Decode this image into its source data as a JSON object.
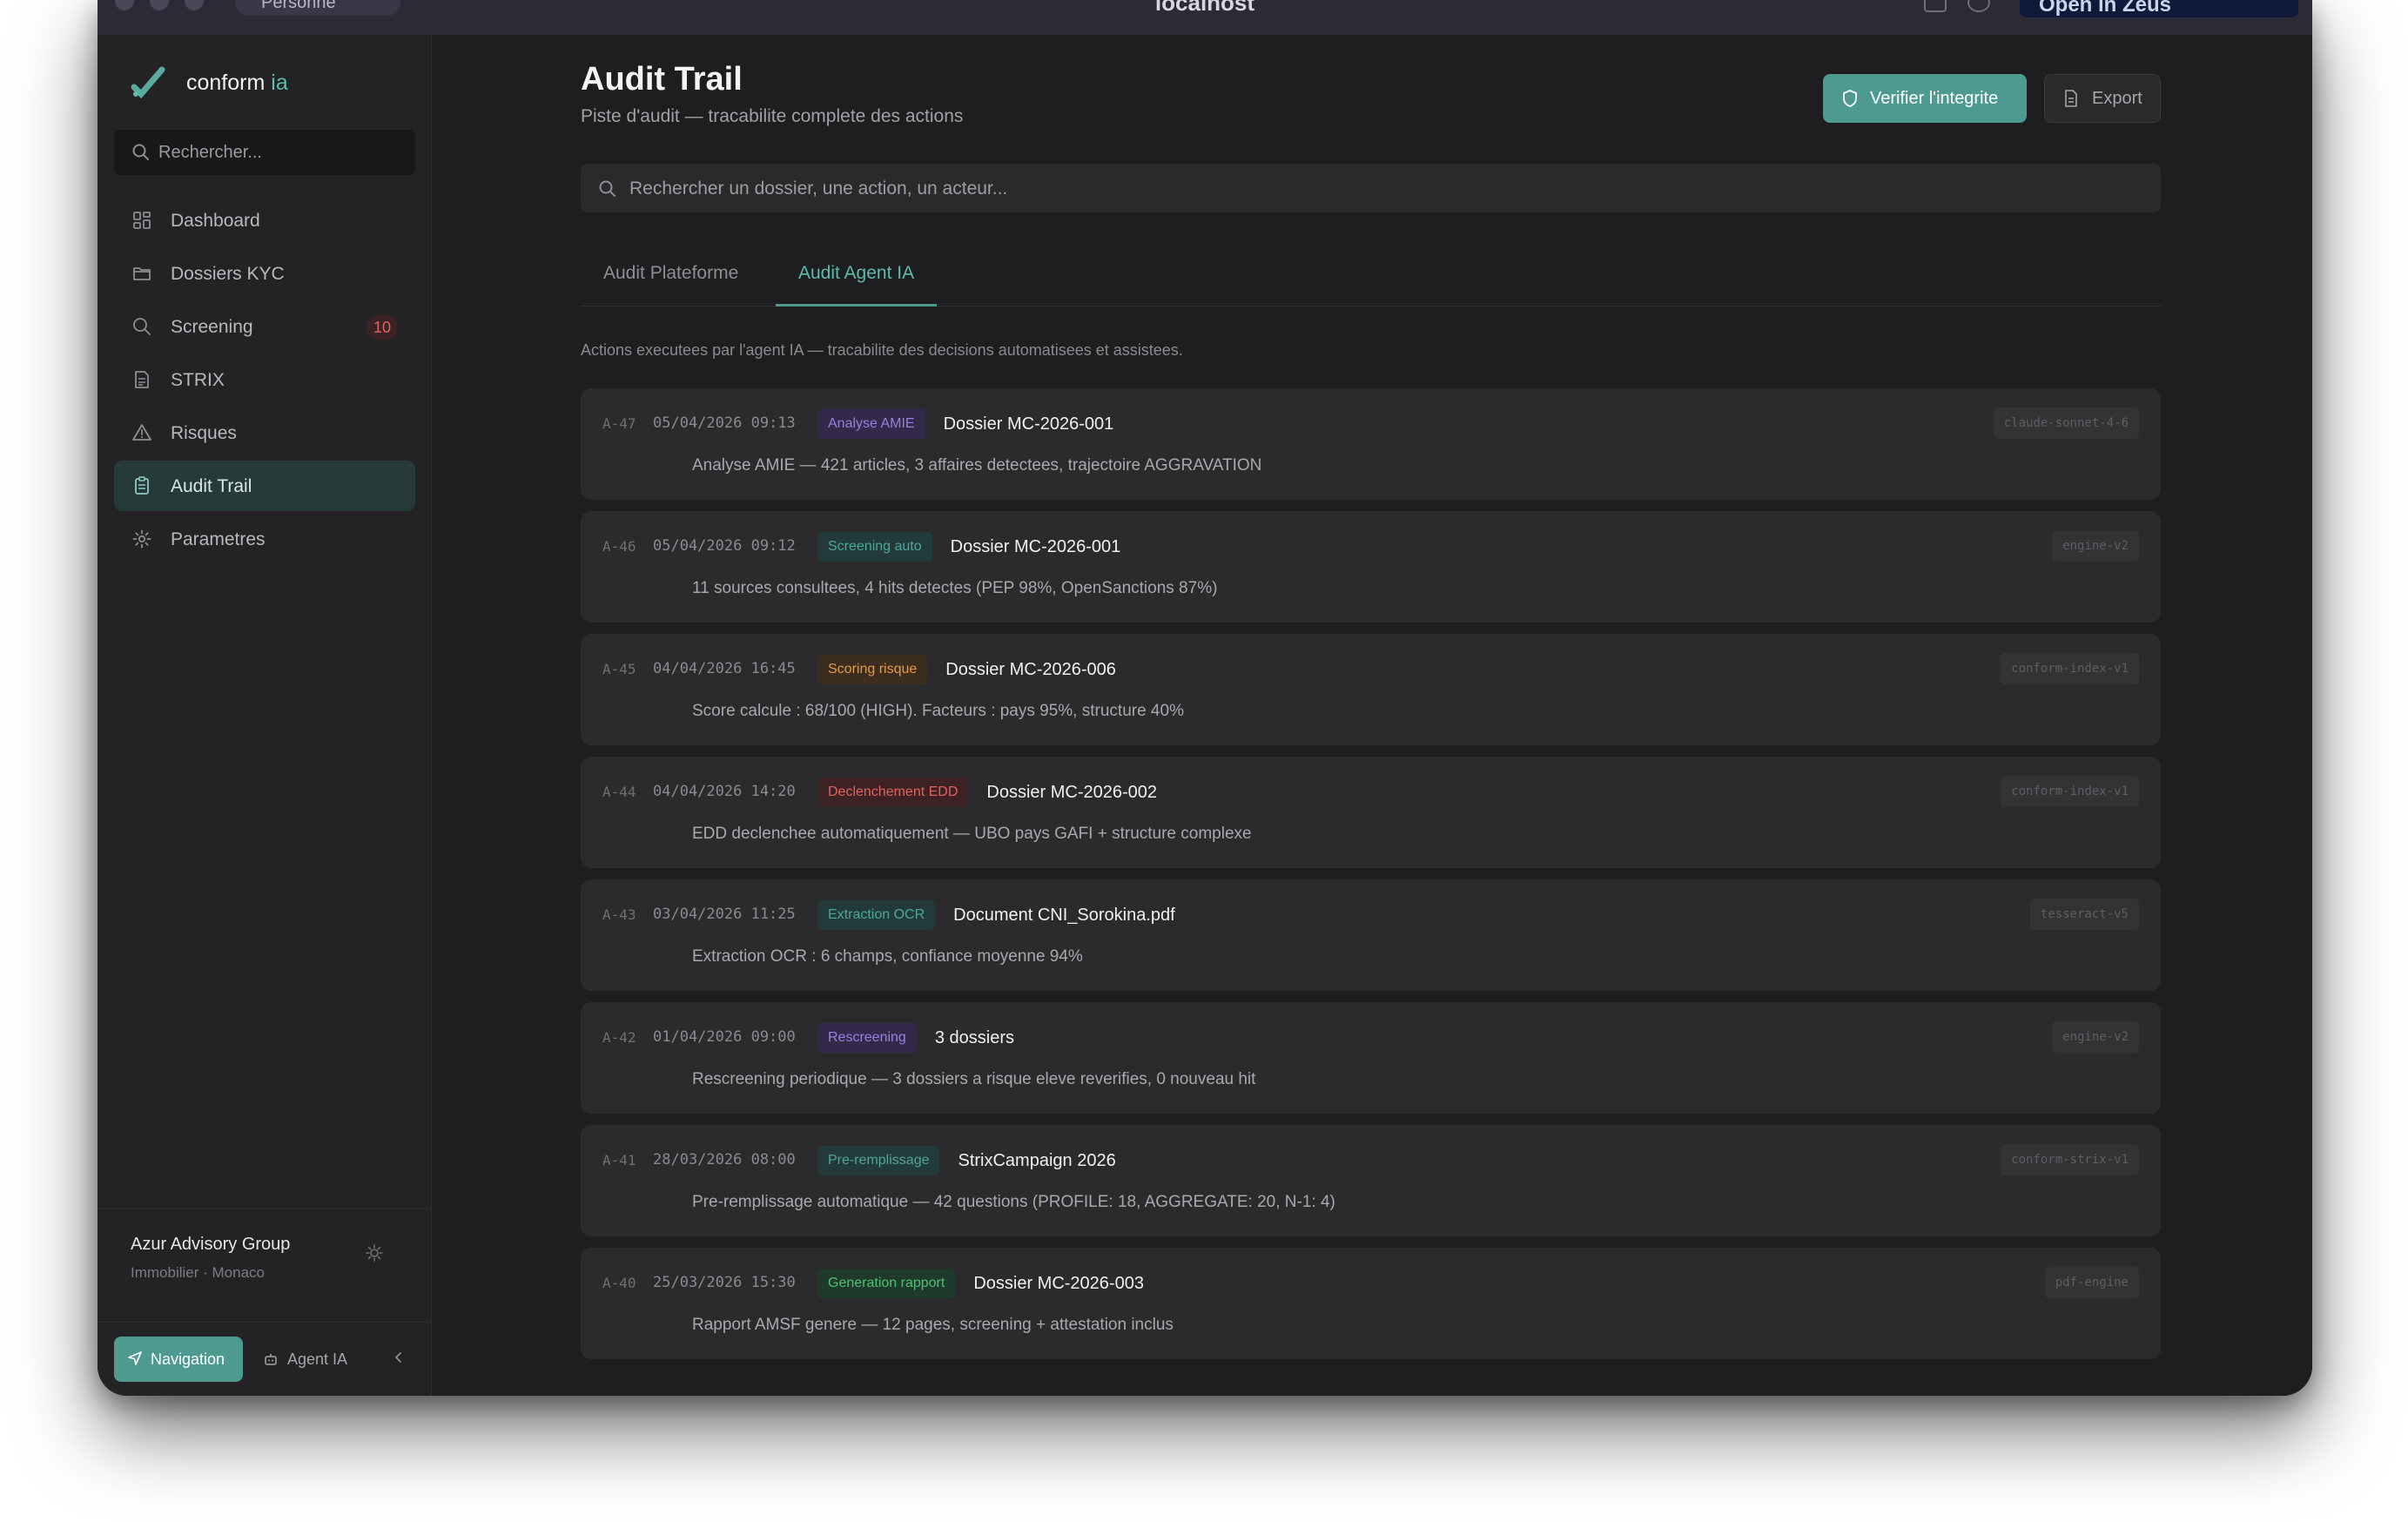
{
  "browser": {
    "host": "localhost",
    "profile_label": "Personne",
    "open_label": "Open in Zeus"
  },
  "sidebar": {
    "brand_name": "conform",
    "brand_accent": "ia",
    "search_placeholder": "Rechercher...",
    "items": [
      {
        "label": "Dashboard",
        "icon": "grid-icon"
      },
      {
        "label": "Dossiers KYC",
        "icon": "folder-icon"
      },
      {
        "label": "Screening",
        "icon": "search-icon",
        "badge": "10"
      },
      {
        "label": "STRIX",
        "icon": "document-icon"
      },
      {
        "label": "Risques",
        "icon": "warning-icon"
      },
      {
        "label": "Audit Trail",
        "icon": "clipboard-icon",
        "active": true
      },
      {
        "label": "Parametres",
        "icon": "gear-icon"
      }
    ],
    "org_name": "Azur Advisory Group",
    "org_sub": "Immobilier · Monaco",
    "bottom": {
      "navigation_label": "Navigation",
      "agent_label": "Agent IA"
    }
  },
  "header": {
    "title": "Audit Trail",
    "subtitle": "Piste d'audit — tracabilite complete des actions",
    "verify_label": "Verifier l'integrite",
    "export_label": "Export"
  },
  "search": {
    "placeholder": "Rechercher un dossier, une action, un acteur..."
  },
  "tabs": [
    {
      "label": "Audit Plateforme",
      "active": false
    },
    {
      "label": "Audit Agent IA",
      "active": true
    }
  ],
  "tab_description": "Actions executees par l'agent IA — tracabilite des decisions automatisees et assistees.",
  "rows": [
    {
      "id": "A-47",
      "time": "05/04/2026 09:13",
      "tag": "Analyse AMIE",
      "subject": "Dossier MC-2026-001",
      "description": "Analyse AMIE — 421 articles, 3 affaires detectees, trajectoire AGGRAVATION",
      "model": "claude-sonnet-4-6"
    },
    {
      "id": "A-46",
      "time": "05/04/2026 09:12",
      "tag": "Screening auto",
      "subject": "Dossier MC-2026-001",
      "description": "11 sources consultees, 4 hits detectes (PEP 98%, OpenSanctions 87%)",
      "model": "engine-v2"
    },
    {
      "id": "A-45",
      "time": "04/04/2026 16:45",
      "tag": "Scoring risque",
      "subject": "Dossier MC-2026-006",
      "description": "Score calcule : 68/100 (HIGH). Facteurs : pays 95%, structure 40%",
      "model": "conform-index-v1"
    },
    {
      "id": "A-44",
      "time": "04/04/2026 14:20",
      "tag": "Declenchement EDD",
      "subject": "Dossier MC-2026-002",
      "description": "EDD declenchee automatiquement — UBO pays GAFI + structure complexe",
      "model": "conform-index-v1"
    },
    {
      "id": "A-43",
      "time": "03/04/2026 11:25",
      "tag": "Extraction OCR",
      "subject": "Document CNI_Sorokina.pdf",
      "description": "Extraction OCR : 6 champs, confiance moyenne 94%",
      "model": "tesseract-v5"
    },
    {
      "id": "A-42",
      "time": "01/04/2026 09:00",
      "tag": "Rescreening",
      "subject": "3 dossiers",
      "description": "Rescreening periodique — 3 dossiers a risque eleve reverifies, 0 nouveau hit",
      "model": "engine-v2"
    },
    {
      "id": "A-41",
      "time": "28/03/2026 08:00",
      "tag": "Pre-remplissage",
      "subject": "StrixCampaign 2026",
      "description": "Pre-remplissage automatique — 42 questions (PROFILE: 18, AGGREGATE: 20, N-1: 4)",
      "model": "conform-strix-v1"
    },
    {
      "id": "A-40",
      "time": "25/03/2026 15:30",
      "tag": "Generation rapport",
      "subject": "Dossier MC-2026-003",
      "description": "Rapport AMSF genere — 12 pages, screening + attestation inclus",
      "model": "pdf-engine"
    }
  ],
  "colors": {
    "accent": "#4e9a90",
    "accent_text": "#5fb9ad",
    "tag_purple_bg": "#33294a",
    "tag_purple_fg": "#9b7fe0",
    "tag_teal_bg": "#223a3a",
    "tag_teal_fg": "#4fa69c",
    "tag_orange_bg": "#3c2d1e",
    "tag_orange_fg": "#e39a45",
    "tag_red_bg": "#3d2224",
    "tag_red_fg": "#e0625e",
    "tag_green_bg": "#1f3a2a",
    "tag_green_fg": "#4fbf76"
  }
}
